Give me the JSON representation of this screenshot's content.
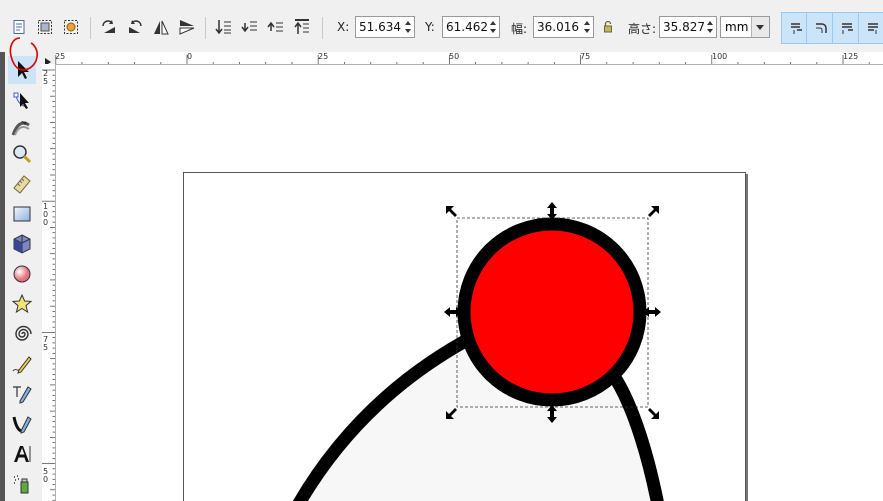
{
  "toolbar": {
    "x_label": "X:",
    "x_value": "51.634",
    "y_label": "Y:",
    "y_value": "61.462",
    "w_label": "幅:",
    "w_value": "36.016",
    "h_label": "高さ:",
    "h_value": "35.827",
    "unit": "mm",
    "icons": [
      "select-all-icon",
      "select-all-layers-icon",
      "deselect-icon",
      "rotate-ccw-icon",
      "rotate-cw-icon",
      "flip-horizontal-icon",
      "flip-vertical-icon",
      "lower-to-bottom-icon",
      "lower-icon",
      "raise-icon",
      "raise-to-top-icon",
      "lock-ratio-icon",
      "scale-stroke-icon",
      "scale-corners-icon",
      "move-gradients-icon",
      "move-patterns-icon"
    ]
  },
  "ruler": {
    "top_labels": [
      "25",
      "0",
      "25",
      "50",
      "75",
      "100",
      "125"
    ],
    "left_labels": [
      "2\n5",
      "1\n0\n0",
      "7\n5",
      "5\n0"
    ]
  },
  "tools": [
    "selector-tool",
    "node-tool",
    "tweak-tool",
    "zoom-tool",
    "measure-tool",
    "rectangle-tool",
    "3d-box-tool",
    "ellipse-tool",
    "star-tool",
    "spiral-tool",
    "pencil-tool",
    "pen-tool",
    "calligraphy-tool",
    "text-tool",
    "spray-tool"
  ],
  "colors": {
    "circle_fill": "#ff0000",
    "stroke": "#000000",
    "snap_active": "#cce4f7",
    "annotation": "#e00000"
  }
}
